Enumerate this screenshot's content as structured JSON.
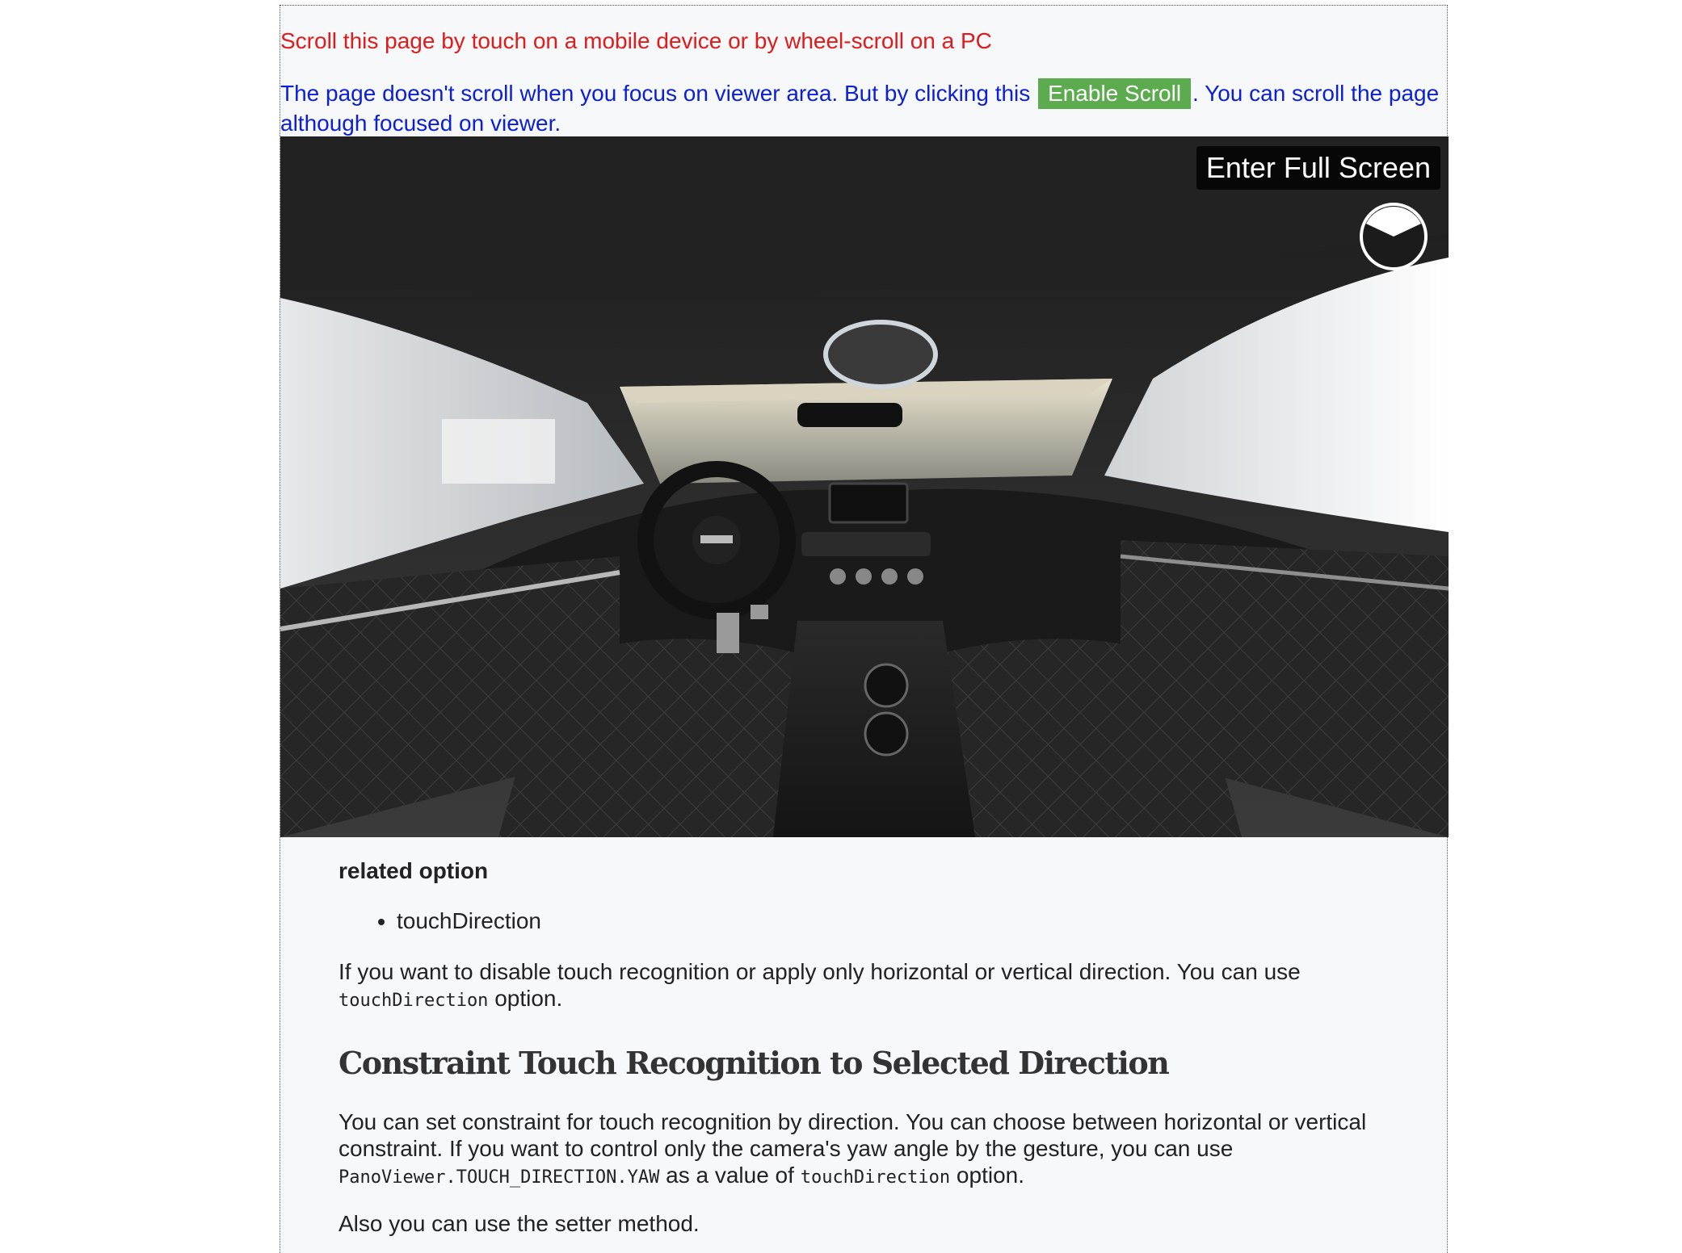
{
  "notices": {
    "scroll_hint": "Scroll this page by touch on a mobile device or by wheel-scroll on a PC",
    "focus_before": "The page doesn't scroll when you focus on viewer area. But by clicking this",
    "enable_scroll_label": "Enable Scroll",
    "focus_after": ". You can scroll the page although focused on viewer."
  },
  "viewer": {
    "fullscreen_label": "Enter Full Screen",
    "pie_icon": "pie-control-icon"
  },
  "doc": {
    "related_heading": "related option",
    "related_items": [
      "touchDirection"
    ],
    "para1_text": "If you want to disable touch recognition or apply only horizontal or vertical direction. You can use ",
    "para1_code": "touchDirection",
    "para1_end": " option.",
    "section_title": "Constraint Touch Recognition to Selected Direction",
    "para2_text": "You can set constraint for touch recognition by direction. You can choose between horizontal or vertical constraint. If you want to control only the camera's yaw angle by the gesture, you can use ",
    "para2_code1": "PanoViewer.TOUCH_DIRECTION.YAW",
    "para2_mid": " as a value of ",
    "para2_code2": "touchDirection",
    "para2_end": " option.",
    "para3": "Also you can use the setter method."
  },
  "colors": {
    "notice_red": "#e01b1b",
    "notice_blue": "#0b1fd6",
    "enable_green": "#5cab4f"
  }
}
